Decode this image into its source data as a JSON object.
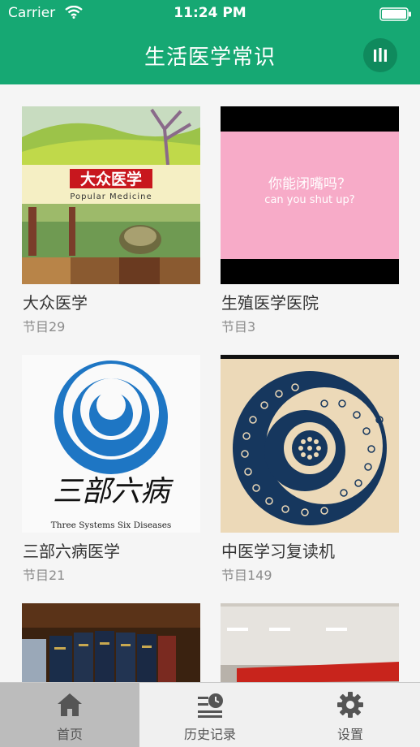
{
  "status_bar": {
    "carrier": "Carrier",
    "time": "11:24 PM"
  },
  "nav": {
    "title": "生活医学常识",
    "menu_icon": "bars-icon"
  },
  "programs": [
    {
      "title": "大众医学",
      "subtitle": "节目29",
      "cover_text": {
        "logo": "大众医学",
        "english": "Popular Medicine"
      }
    },
    {
      "title": "生殖医学医院",
      "subtitle": "节目3",
      "cover_text": {
        "line1": "你能闭嘴吗？",
        "line2": "can you shut up?"
      }
    },
    {
      "title": "三部六病医学",
      "subtitle": "节目21",
      "cover_text": {
        "logo": "三部六病",
        "english": "Three Systems Six Diseases"
      }
    },
    {
      "title": "中医学习复读机",
      "subtitle": "节目149"
    },
    {
      "title": "",
      "subtitle": ""
    },
    {
      "title": "",
      "subtitle": ""
    }
  ],
  "tabbar": [
    {
      "label": "首页",
      "icon": "home-icon",
      "active": true
    },
    {
      "label": "历史记录",
      "icon": "history-icon",
      "active": false
    },
    {
      "label": "设置",
      "icon": "gear-icon",
      "active": false
    }
  ],
  "colors": {
    "accent": "#16a873",
    "tab_active": "#bcbcbc"
  }
}
